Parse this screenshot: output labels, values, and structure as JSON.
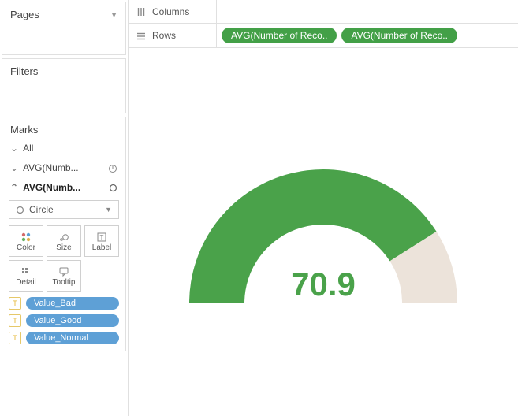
{
  "pages": {
    "title": "Pages"
  },
  "filters": {
    "title": "Filters"
  },
  "marks": {
    "title": "Marks",
    "all_label": "All",
    "layer1_label": "AVG(Numb...",
    "layer2_label": "AVG(Numb...",
    "mark_type": "Circle",
    "buttons": {
      "color": "Color",
      "size": "Size",
      "label": "Label",
      "detail": "Detail",
      "tooltip": "Tooltip"
    },
    "pills": [
      "Value_Bad",
      "Value_Good",
      "Value_Normal"
    ]
  },
  "shelves": {
    "columns_label": "Columns",
    "rows_label": "Rows",
    "rows_pills": [
      "AVG(Number of Reco..",
      "AVG(Number of Reco.."
    ]
  },
  "chart_data": {
    "type": "gauge",
    "title": "",
    "value": 70.9,
    "display_value": "70.9",
    "min": 0,
    "max": 100,
    "fill_fraction": 0.82,
    "colors": {
      "fill": "#4aa24a",
      "track": "#ece3da",
      "value_text": "#4aa24a"
    }
  }
}
